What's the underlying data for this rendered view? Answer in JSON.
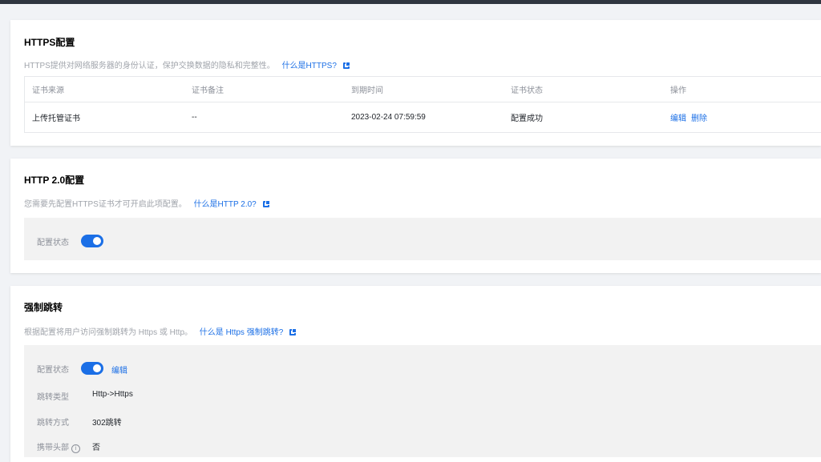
{
  "https": {
    "title": "HTTPS配置",
    "desc": "HTTPS提供对网络服务器的身份认证，保护交换数据的隐私和完整性。",
    "help_link": "什么是HTTPS?",
    "columns": [
      "证书来源",
      "证书备注",
      "到期时间",
      "证书状态",
      "操作"
    ],
    "rows": [
      {
        "source": "上传托管证书",
        "note": "--",
        "expire": "2023-02-24 07:59:59",
        "status": "配置成功",
        "edit": "编辑",
        "delete": "删除"
      }
    ]
  },
  "http2": {
    "title": "HTTP 2.0配置",
    "desc": "您需要先配置HTTPS证书才可开启此项配置。",
    "help_link": "什么是HTTP 2.0?",
    "status_label": "配置状态",
    "enabled": true
  },
  "redirect": {
    "title": "强制跳转",
    "desc": "根据配置将用户访问强制跳转为 Https 或 Http。",
    "help_link": "什么是 Https 强制跳转?",
    "status_label": "配置状态",
    "enabled": true,
    "edit_label": "编辑",
    "type_label": "跳转类型",
    "type_value": "Http->Https",
    "method_label": "跳转方式",
    "method_value": "302跳转",
    "header_label": "携带头部",
    "header_value": "否"
  },
  "colors": {
    "accent": "#1b6fe6",
    "page_bg": "#f1f3f6",
    "panel_bg": "#f2f2f2"
  }
}
